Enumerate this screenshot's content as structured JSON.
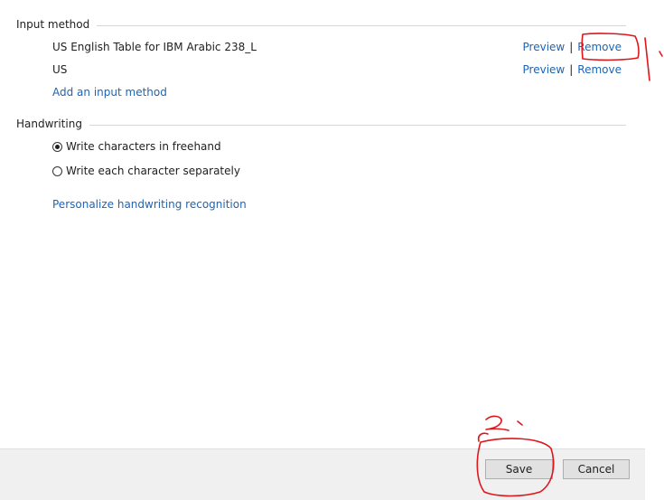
{
  "input_method": {
    "title": "Input method",
    "items": [
      {
        "name": "US English Table for IBM Arabic 238_L",
        "preview": "Preview",
        "separator": "|",
        "remove": "Remove"
      },
      {
        "name": "US",
        "preview": "Preview",
        "separator": "|",
        "remove": "Remove"
      }
    ],
    "add_link": "Add an input method"
  },
  "handwriting": {
    "title": "Handwriting",
    "options": [
      {
        "label": "Write characters in freehand",
        "checked": true
      },
      {
        "label": "Write each character separately",
        "checked": false
      }
    ],
    "personalize_link": "Personalize handwriting recognition"
  },
  "footer": {
    "save_label": "Save",
    "cancel_label": "Cancel"
  },
  "annotation": {
    "color": "#e0161d"
  }
}
